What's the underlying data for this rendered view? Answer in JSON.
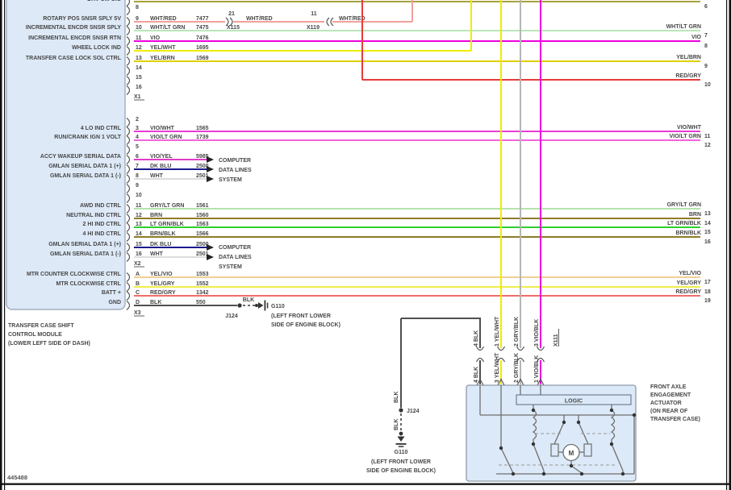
{
  "page": {
    "doc_number": "445488"
  },
  "module": {
    "title_lines": [
      "TRANSFER CASE SHIFT",
      "CONTROL MODULE",
      "(LOWER LEFT SIDE OF DASH)"
    ],
    "cut_top_label": "DRV SW SIG"
  },
  "colors": {
    "WHT/RED": "#f2a09b",
    "WHT/LT GRN": "#b9e7b9",
    "VIO": "#ee00dd",
    "YEL/WHT": "#f0ec00",
    "YEL/BRN": "#e0cf00",
    "RED_FEED": "#e63b3b",
    "VIO/WHT": "#ea3cd7",
    "VIO/LT GRN": "#f065dc",
    "VIO/YEL": "#e13bc8",
    "DK BLU": "#1b1b8d",
    "WHT": "#dcdcdc",
    "GRY/LT GRN": "#b4e3ac",
    "BRN": "#907c26",
    "LT GRN/BLK": "#2fcf2f",
    "BRN/BLK": "#8f7b25",
    "YEL/VIO": "#f1cf94",
    "YEL/GRY": "#eded4a",
    "RED/GRY": "#ef6d68",
    "BLK": "#4f4f4f",
    "GRY/BLK": "#b5b5b5",
    "VIO/BLK": "#ee00dd",
    "DRV_SW_SIG": "#a8a23c"
  },
  "x1": {
    "label": "X1",
    "rows": [
      {
        "pin": "8"
      },
      {
        "pin": "9",
        "fn": "ROTARY POS SNSR SPLY 5V",
        "wire": "WHT/RED",
        "ckt": "7477"
      },
      {
        "pin": "10",
        "fn": "INCREMENTAL ENCDR SNSR SPLY",
        "wire": "WHT/LT GRN",
        "ckt": "7475"
      },
      {
        "pin": "11",
        "fn": "INCREMENTAL ENCDR SNSR RTN",
        "wire": "VIO",
        "ckt": "7476"
      },
      {
        "pin": "12",
        "fn": "WHEEL LOCK IND",
        "wire": "YEL/WHT",
        "ckt": "1695"
      },
      {
        "pin": "13",
        "fn": "TRANSFER CASE LOCK SOL CTRL",
        "wire": "YEL/BRN",
        "ckt": "1569"
      },
      {
        "pin": "14"
      },
      {
        "pin": "15"
      },
      {
        "pin": "16"
      }
    ]
  },
  "x2": {
    "label": "X2",
    "rows": [
      {
        "pin": "2"
      },
      {
        "pin": "3",
        "fn": "4 LO IND CTRL",
        "wire": "VIO/WHT",
        "ckt": "1565"
      },
      {
        "pin": "4",
        "fn": "RUN/CRANK IGN 1 VOLT",
        "wire": "VIO/LT GRN",
        "ckt": "1739"
      },
      {
        "pin": "5"
      },
      {
        "pin": "6",
        "fn": "ACCY WAKEUP SERIAL DATA",
        "wire": "VIO/YEL",
        "ckt": "5985"
      },
      {
        "pin": "7",
        "fn": "GMLAN SERIAL DATA 1 (+)",
        "wire": "DK BLU",
        "ckt": "2500"
      },
      {
        "pin": "8",
        "fn": "GMLAN SERIAL DATA 1 (-)",
        "wire": "WHT",
        "ckt": "2501"
      },
      {
        "pin": "9"
      },
      {
        "pin": "10"
      },
      {
        "pin": "11",
        "fn": "AWD IND CTRL",
        "wire": "GRY/LT GRN",
        "ckt": "1561"
      },
      {
        "pin": "12",
        "fn": "NEUTRAL IND CTRL",
        "wire": "BRN",
        "ckt": "1560"
      },
      {
        "pin": "13",
        "fn": "2 HI IND CTRL",
        "wire": "LT GRN/BLK",
        "ckt": "1563"
      },
      {
        "pin": "14",
        "fn": "4 HI IND CTRL",
        "wire": "BRN/BLK",
        "ckt": "1566"
      },
      {
        "pin": "15",
        "fn": "GMLAN SERIAL DATA 1 (+)",
        "wire": "DK BLU",
        "ckt": "2500"
      },
      {
        "pin": "16",
        "fn": "GMLAN SERIAL DATA 1 (-)",
        "wire": "WHT",
        "ckt": "2501"
      }
    ]
  },
  "x3": {
    "label": "X3",
    "rows": [
      {
        "pin": "A",
        "fn": "MTR COUNTER CLOCKWISE CTRL",
        "wire": "YEL/VIO",
        "ckt": "1553"
      },
      {
        "pin": "B",
        "fn": "MTR CLOCKWISE CTRL",
        "wire": "YEL/GRY",
        "ckt": "1552"
      },
      {
        "pin": "C",
        "fn": "BATT +",
        "wire": "RED/GRY",
        "ckt": "1342"
      },
      {
        "pin": "D",
        "fn": "GND",
        "wire": "BLK",
        "ckt": "550"
      }
    ]
  },
  "right_edge": {
    "pins": [
      {
        "pin": "6",
        "color": ""
      },
      {
        "pin": "7",
        "color": "WHT/LT GRN"
      },
      {
        "pin": "8",
        "color": "VIO"
      },
      {
        "pin": "9",
        "color": "YEL/BRN"
      },
      {
        "pin": "10",
        "color": "RED/GRY"
      },
      {
        "pin": "11",
        "color": "VIO/WHT"
      },
      {
        "pin": "12",
        "color": "VIO/LT GRN"
      },
      {
        "pin": "13",
        "color": "GRY/LT GRN"
      },
      {
        "pin": "14",
        "color": "BRN"
      },
      {
        "pin": "15",
        "color": "LT GRN/BLK"
      },
      {
        "pin": "16",
        "color": "BRN/BLK"
      },
      {
        "pin": "17",
        "color": "YEL/VIO"
      },
      {
        "pin": "18",
        "color": "YEL/GRY"
      },
      {
        "pin": "19",
        "color": "RED/GRY"
      }
    ]
  },
  "inline": {
    "x115": {
      "label": "X115",
      "pin": "21",
      "wire": "WHT/RED"
    },
    "x119": {
      "label": "X119",
      "pin": "11",
      "wire": "WHT/RED"
    },
    "x111": {
      "label": "X111",
      "top": [
        "4 BLK",
        "1 YEL/WHT",
        "2 GRY/BLK",
        "3 VIO/BLK"
      ],
      "bottom": [
        "4 BLK",
        "3 YEL/WHT",
        "2 GRY/BLK",
        "1 VIO/BLK"
      ]
    }
  },
  "computer": {
    "lines": [
      "COMPUTER",
      "DATA LINES",
      "SYSTEM"
    ]
  },
  "grounds": {
    "module_side": {
      "splice": "J124",
      "wire": "BLK",
      "name": "G110",
      "loc_lines": [
        "(LEFT FRONT LOWER",
        "SIDE OF ENGINE BLOCK)"
      ]
    },
    "bottom": {
      "splice": "J124",
      "wire_upper": "BLK",
      "wire_lower": "BLK",
      "name": "G110",
      "loc_lines": [
        "(LEFT FRONT LOWER",
        "SIDE OF ENGINE BLOCK)"
      ]
    }
  },
  "actuator": {
    "label_lines": [
      "FRONT AXLE",
      "ENGAGEMENT",
      "ACTUATOR",
      "(ON REAR OF",
      "TRANSFER CASE)"
    ],
    "logic_label": "LOGIC",
    "motor_label": "M"
  }
}
